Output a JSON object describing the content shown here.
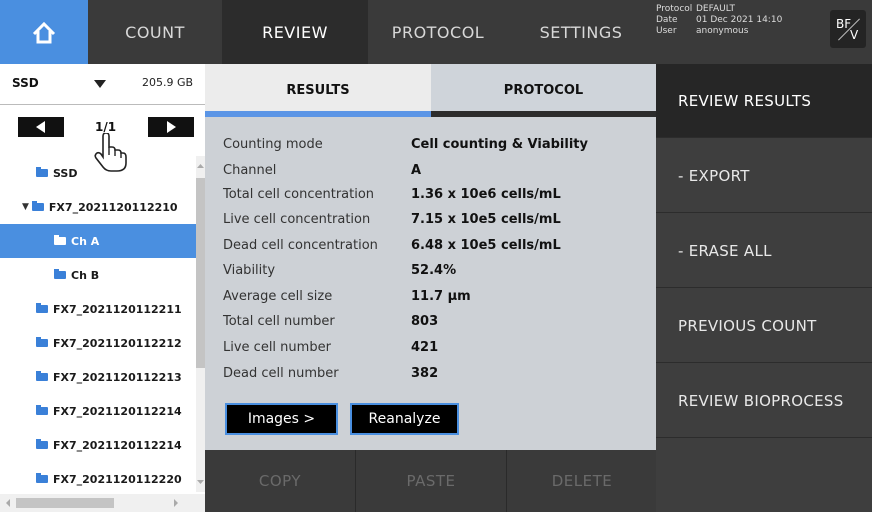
{
  "nav": {
    "tabs": [
      {
        "label": "COUNT"
      },
      {
        "label": "REVIEW"
      },
      {
        "label": "PROTOCOL"
      },
      {
        "label": "SETTINGS"
      }
    ],
    "active": "REVIEW"
  },
  "info": {
    "protocol_key": "Protocol",
    "protocol_val": "DEFAULT",
    "date_key": "Date",
    "date_val": "01 Dec 2021 14:10",
    "user_key": "User",
    "user_val": "anonymous"
  },
  "mode_toggle": {
    "top": "BF",
    "bottom": "V"
  },
  "storage": {
    "selected": "SSD",
    "size": "205.9 GB"
  },
  "pager": {
    "page": "1/1"
  },
  "tree": [
    {
      "label": "SSD",
      "level": 0,
      "expander": ""
    },
    {
      "label": "FX7_2021120112210",
      "level": 0,
      "expander": "▼"
    },
    {
      "label": "Ch A",
      "level": 1,
      "selected": true
    },
    {
      "label": "Ch B",
      "level": 1
    },
    {
      "label": "FX7_2021120112211",
      "level": 0
    },
    {
      "label": "FX7_2021120112212",
      "level": 0
    },
    {
      "label": "FX7_2021120112213",
      "level": 0
    },
    {
      "label": "FX7_2021120112214",
      "level": 0
    },
    {
      "label": "FX7_2021120112214",
      "level": 0
    },
    {
      "label": "FX7_2021120112220",
      "level": 0
    }
  ],
  "center_tabs": {
    "results": "RESULTS",
    "protocol": "PROTOCOL"
  },
  "results": [
    {
      "key": "Counting mode",
      "value": "Cell counting & Viability"
    },
    {
      "key": "Channel",
      "value": "A"
    },
    {
      "key": "Total cell concentration",
      "value": "1.36 x 10e6 cells/mL"
    },
    {
      "key": "Live cell concentration",
      "value": "7.15 x 10e5 cells/mL"
    },
    {
      "key": "Dead cell concentration",
      "value": "6.48 x 10e5 cells/mL"
    },
    {
      "key": "Viability",
      "value": "52.4%"
    },
    {
      "key": "Average cell size",
      "value": "11.7 µm"
    },
    {
      "key": "Total cell number",
      "value": "803"
    },
    {
      "key": "Live cell number",
      "value": "421"
    },
    {
      "key": "Dead cell number",
      "value": "382"
    }
  ],
  "panel_buttons": {
    "images": "Images >",
    "reanalyze": "Reanalyze"
  },
  "bottom_buttons": {
    "copy": "COPY",
    "paste": "PASTE",
    "delete": "DELETE"
  },
  "right_menu": [
    {
      "label": "REVIEW RESULTS",
      "active": true
    },
    {
      "label": "- EXPORT"
    },
    {
      "label": "- ERASE ALL"
    },
    {
      "label": "PREVIOUS COUNT"
    },
    {
      "label": "REVIEW BIOPROCESS"
    }
  ],
  "colors": {
    "accent": "#4a8fe0",
    "topbar": "#3a3a3a",
    "panel": "#cdd1d6"
  }
}
